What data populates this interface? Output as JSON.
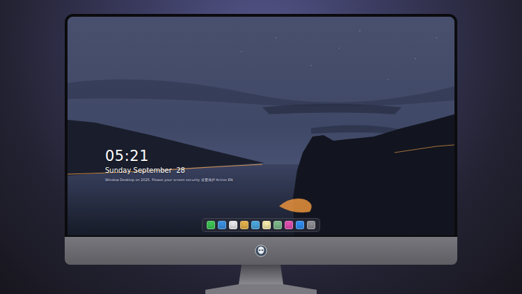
{
  "lock_screen": {
    "time": "05:21",
    "date": "Sunday September  28",
    "notice": "Window Desktop on 2025. Please your screen security 设置保护 Action EN"
  },
  "dock": {
    "items": [
      {
        "color": "#3ec455"
      },
      {
        "color": "#3a8fe0"
      },
      {
        "color": "#e8e8ea"
      },
      {
        "color": "#e3b04a"
      },
      {
        "color": "#4aa6dc"
      },
      {
        "color": "#f4e9a8"
      },
      {
        "color": "#7cb88a"
      },
      {
        "color": "#e04fb0"
      },
      {
        "color": "#2f8cf0"
      },
      {
        "color": "#8e8e93"
      }
    ]
  }
}
